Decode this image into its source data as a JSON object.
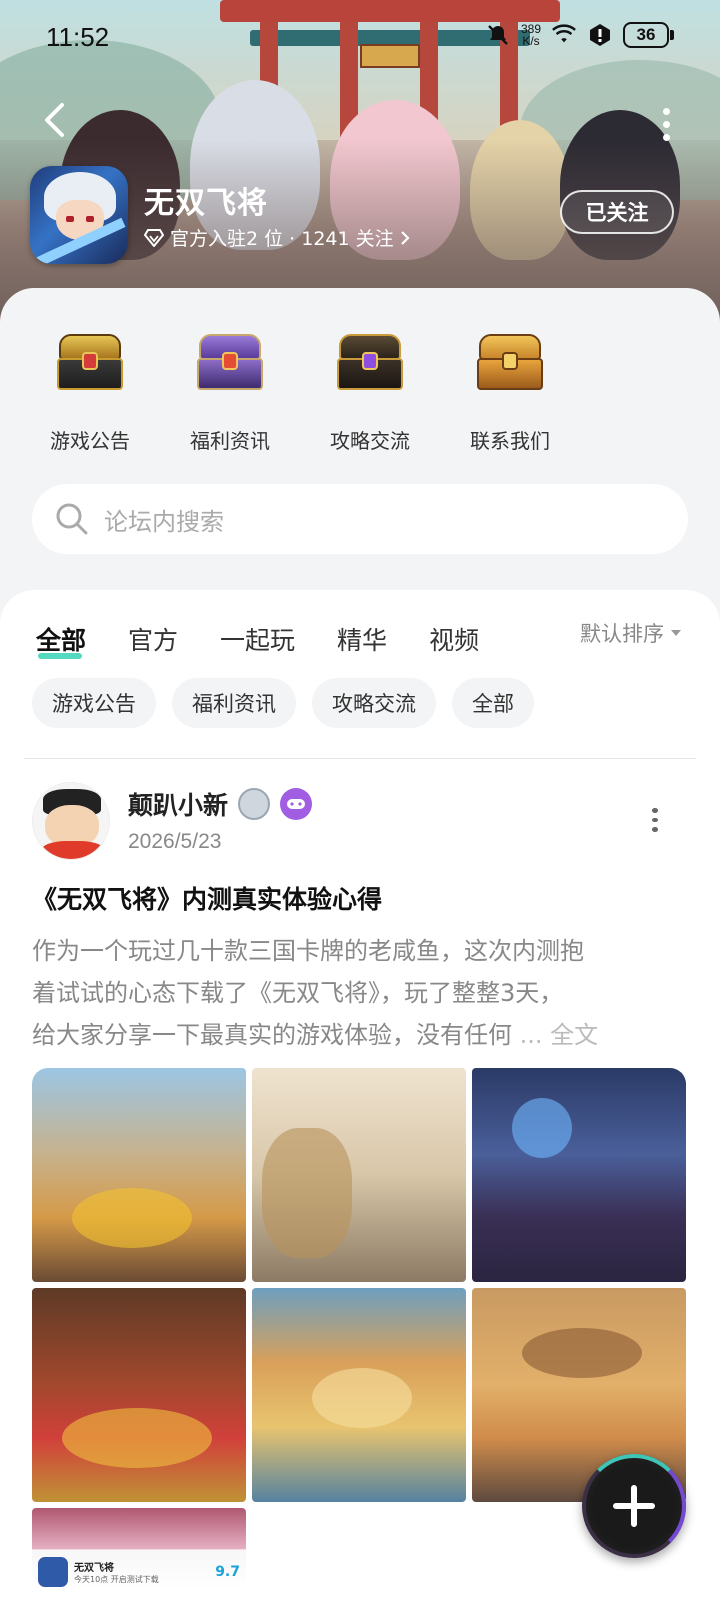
{
  "status_bar": {
    "time": "11:52",
    "speed_value": "389",
    "speed_unit": "K/s",
    "battery": "36"
  },
  "header": {
    "app_name": "无双飞将",
    "meta_text": "官方入驻2 位 · 1241 关注",
    "follow_label": "已关注"
  },
  "quick_links": [
    {
      "label": "游戏公告",
      "icon": "gold-chest-icon",
      "color": "#c99a2e"
    },
    {
      "label": "福利资讯",
      "icon": "purple-chest-icon",
      "color": "#7b5bbf"
    },
    {
      "label": "攻略交流",
      "icon": "dark-chest-icon",
      "color": "#6d5a3a"
    },
    {
      "label": "联系我们",
      "icon": "treasure-chest-icon",
      "color": "#c8862b"
    }
  ],
  "search": {
    "placeholder": "论坛内搜索"
  },
  "tabs": [
    {
      "label": "全部",
      "active": true
    },
    {
      "label": "官方",
      "active": false
    },
    {
      "label": "一起玩",
      "active": false
    },
    {
      "label": "精华",
      "active": false
    },
    {
      "label": "视频",
      "active": false
    }
  ],
  "sort_label": "默认排序",
  "chips": [
    "游戏公告",
    "福利资讯",
    "攻略交流",
    "全部"
  ],
  "post": {
    "author": "颠趴小新",
    "date": "2026/5/23",
    "title": "《无双飞将》内测真实体验心得",
    "body_lines": [
      "作为一个玩过几十款三国卡牌的老咸鱼，这次内测抱",
      "着试试的心态下载了《无双飞将》，玩了整整3天，",
      "给大家分享一下最真实的游戏体验，没有任何"
    ],
    "ellipsis": " ... ",
    "full_text_label": "全文",
    "mini_card": {
      "title": "无双飞将",
      "subtitle": "今天10点 开启测试下载",
      "score": "9.7"
    }
  },
  "colors": {
    "accent": "#36d1b5",
    "tag_bg": "#f3f4f6"
  }
}
